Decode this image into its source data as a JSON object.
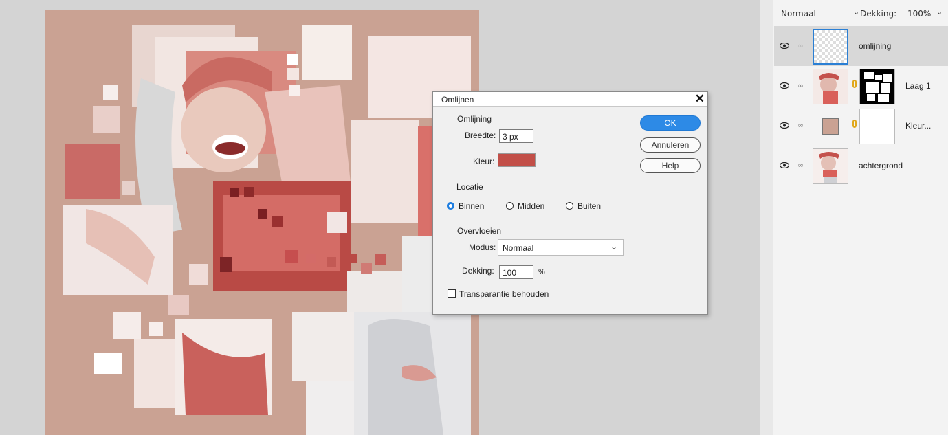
{
  "layers_panel": {
    "blend_mode": "Normaal",
    "opacity_label": "Dekking:",
    "opacity_value": "100%",
    "layers": [
      {
        "name": "omlijning",
        "selected": true
      },
      {
        "name": "Laag 1",
        "selected": false
      },
      {
        "name": "Kleur...",
        "selected": false
      },
      {
        "name": "achtergrond",
        "selected": false
      }
    ]
  },
  "dialog": {
    "title": "Omlijnen",
    "section_stroke": "Omlijning",
    "width_label": "Breedte:",
    "width_value": "3 px",
    "color_label": "Kleur:",
    "stroke_color": "#c24f48",
    "section_location": "Locatie",
    "location_options": [
      {
        "label": "Binnen",
        "selected": true
      },
      {
        "label": "Midden",
        "selected": false
      },
      {
        "label": "Buiten",
        "selected": false
      }
    ],
    "section_blend": "Overvloeien",
    "mode_label": "Modus:",
    "mode_value": "Normaal",
    "opacity_label": "Dekking:",
    "opacity_value": "100",
    "opacity_unit": "%",
    "preserve_transparency_label": "Transparantie behouden",
    "preserve_transparency_checked": false,
    "ok_label": "OK",
    "cancel_label": "Annuleren",
    "help_label": "Help"
  },
  "colors": {
    "canvas_background": "#caa293",
    "accent": "#2d8ae6"
  }
}
